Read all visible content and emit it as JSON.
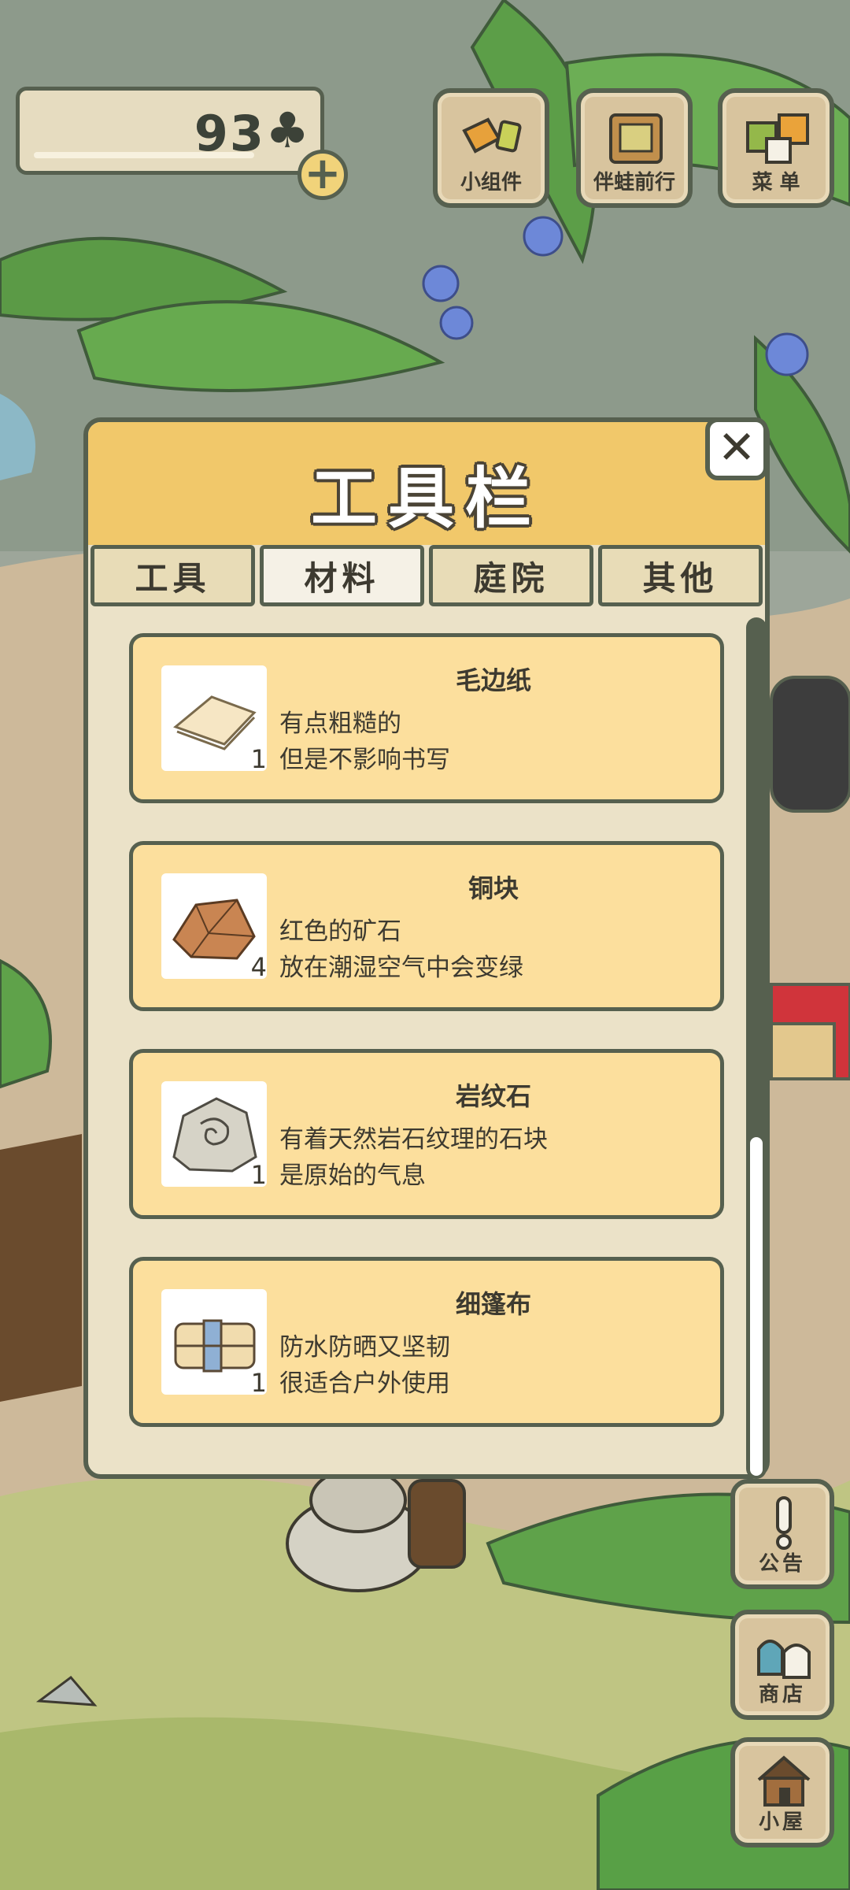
{
  "currency": {
    "count": "93",
    "icon": "clover-icon"
  },
  "top_buttons": [
    {
      "label": "小组件",
      "icon": "widget-icon"
    },
    {
      "label": "伴蛙前行",
      "icon": "photo-frame-icon"
    },
    {
      "label": "菜 单",
      "icon": "menu-cards-icon"
    }
  ],
  "dialog": {
    "title": "工具栏",
    "close_symbol": "✕",
    "tabs": [
      {
        "label": "工具",
        "active": false
      },
      {
        "label": "材料",
        "active": true
      },
      {
        "label": "庭院",
        "active": false
      },
      {
        "label": "其他",
        "active": false
      }
    ],
    "items": [
      {
        "name": "毛边纸",
        "desc1": "有点粗糙的",
        "desc2": "但是不影响书写",
        "qty": "1",
        "icon": "paper-icon"
      },
      {
        "name": "铜块",
        "desc1": "红色的矿石",
        "desc2": "放在潮湿空气中会变绿",
        "qty": "4",
        "icon": "copper-ore-icon"
      },
      {
        "name": "岩纹石",
        "desc1": "有着天然岩石纹理的石块",
        "desc2": "是原始的气息",
        "qty": "1",
        "icon": "stone-icon"
      },
      {
        "name": "细篷布",
        "desc1": "防水防晒又坚韧",
        "desc2": "很适合户外使用",
        "qty": "1",
        "icon": "canvas-cloth-icon"
      }
    ]
  },
  "side_buttons": [
    {
      "label": "公告",
      "icon": "exclamation-icon"
    },
    {
      "label": "商店",
      "icon": "shop-bags-icon"
    },
    {
      "label": "小屋",
      "icon": "house-icon"
    }
  ],
  "colors": {
    "outline": "#56604f",
    "header": "#f1c86a",
    "item_bg": "#fcdf9d",
    "panel_bg": "#ebe2c8"
  }
}
